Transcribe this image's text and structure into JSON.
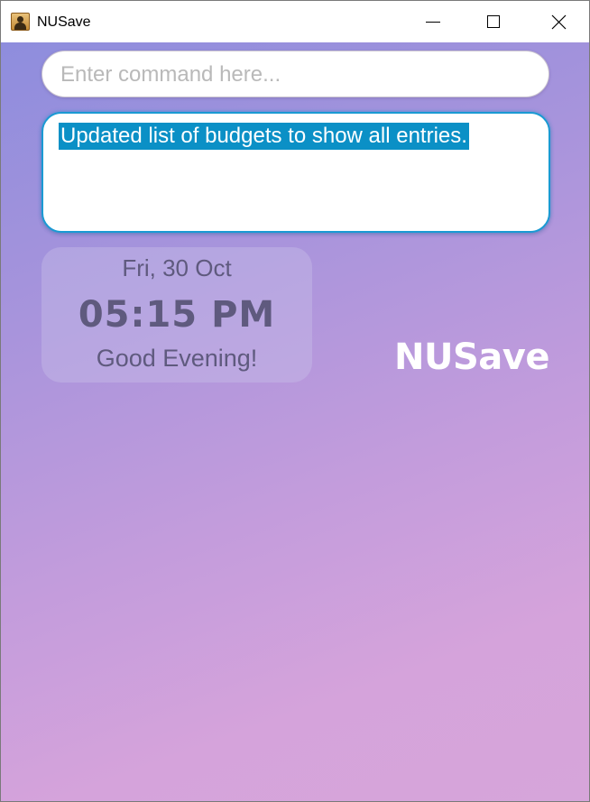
{
  "window": {
    "title": "NUSave",
    "app_icon": "contact-book-icon"
  },
  "command": {
    "placeholder": "Enter command here...",
    "value": ""
  },
  "result": {
    "message": "Updated list of budgets to show all entries."
  },
  "clock": {
    "date": "Fri, 30 Oct",
    "time": "05:15 PM",
    "greeting": "Good Evening!"
  },
  "brand": {
    "name": "NUSave"
  },
  "colors": {
    "accent": "#1a9ad3",
    "selection": "#0b90c6",
    "gradient_start": "#8e8ddd",
    "gradient_end": "#d6a5da",
    "clock_text": "#5f5a7e"
  }
}
